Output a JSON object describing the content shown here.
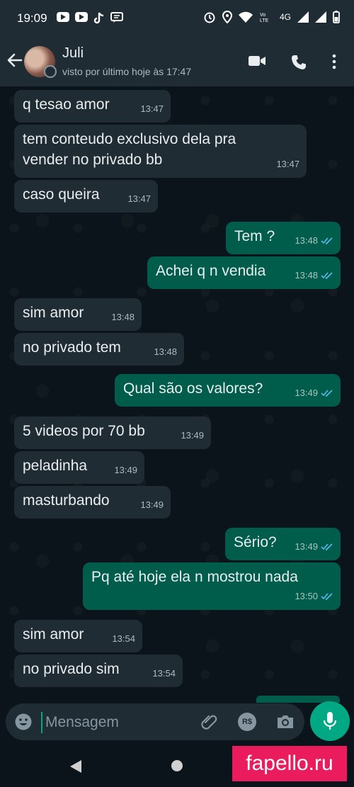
{
  "statusbar": {
    "time": "19:09",
    "network": "4G"
  },
  "header": {
    "name": "Juli",
    "status": "visto por último hoje às 17:47"
  },
  "messages": [
    {
      "dir": "in",
      "text": "q tesao amor",
      "time": "13:47"
    },
    {
      "dir": "in",
      "text": "tem conteudo exclusivo dela pra vender no privado bb",
      "time": "13:47"
    },
    {
      "dir": "in",
      "text": "caso queira",
      "time": "13:47"
    },
    {
      "dir": "out",
      "text": "Tem ?",
      "time": "13:48"
    },
    {
      "dir": "out",
      "text": "Achei q n vendia",
      "time": "13:48"
    },
    {
      "dir": "in",
      "text": "sim amor",
      "time": "13:48"
    },
    {
      "dir": "in",
      "text": "no privado tem",
      "time": "13:48"
    },
    {
      "dir": "out",
      "text": "Qual são os valores?",
      "time": "13:49"
    },
    {
      "dir": "in",
      "text": "5 videos por 70 bb",
      "time": "13:49"
    },
    {
      "dir": "in",
      "text": "peladinha",
      "time": "13:49"
    },
    {
      "dir": "in",
      "text": "masturbando",
      "time": "13:49"
    },
    {
      "dir": "out",
      "text": "Sério?",
      "time": "13:49"
    },
    {
      "dir": "out",
      "text": "Pq até hoje ela n mostrou nada",
      "time": "13:50"
    },
    {
      "dir": "in",
      "text": "sim amor",
      "time": "13:54"
    },
    {
      "dir": "in",
      "text": "no privado sim",
      "time": "13:54"
    }
  ],
  "composer": {
    "placeholder": "Mensagem",
    "currency_label": "R$"
  },
  "watermark": "fapello.ru",
  "colors": {
    "accent": "#00a884",
    "incoming": "#202c33",
    "outgoing": "#005c4b",
    "read_ticks": "#53bdeb"
  }
}
